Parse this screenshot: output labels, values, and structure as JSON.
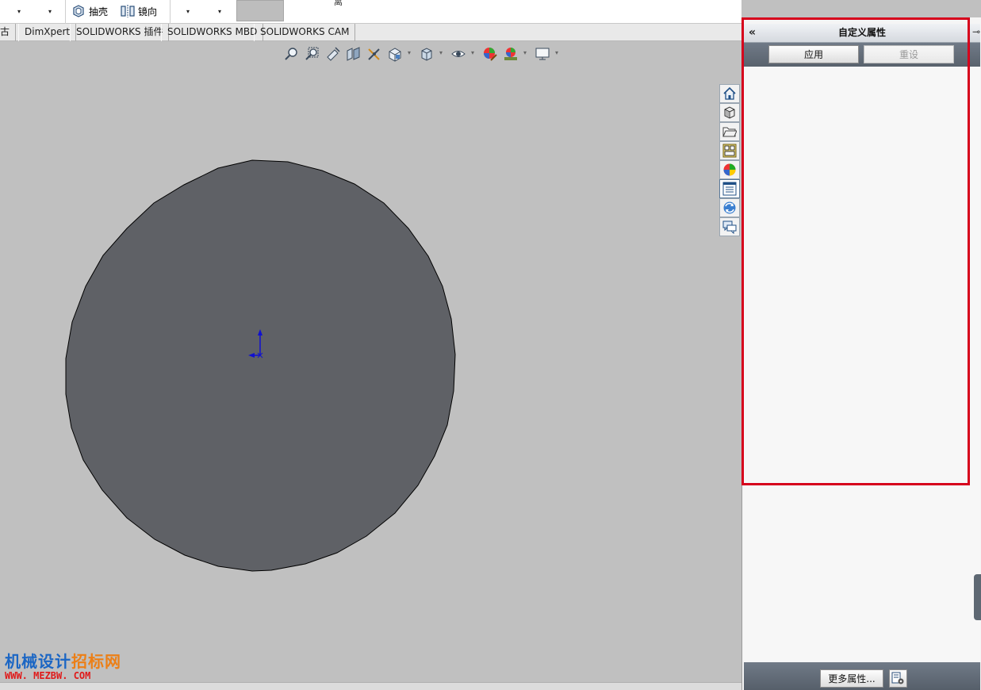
{
  "toolbar": {
    "shell_label": "抽壳",
    "mirror_label": "镜向",
    "top_char": "离"
  },
  "tabs": [
    {
      "label": "古"
    },
    {
      "label": "DimXpert"
    },
    {
      "label": "SOLIDWORKS 插件"
    },
    {
      "label": "SOLIDWORKS MBD"
    },
    {
      "label": "SOLIDWORKS CAM"
    }
  ],
  "heads_up_icons": [
    "zoom-to-fit-icon",
    "zoom-to-area-icon",
    "previous-view-icon",
    "section-view-icon",
    "dynamic-annotation-icon",
    "view-orientation-icon",
    "display-style-icon",
    "hide-show-items-icon",
    "edit-appearance-icon",
    "apply-scene-icon",
    "view-settings-icon"
  ],
  "task_pane_icons": [
    "home-icon",
    "design-library-icon",
    "file-explorer-icon",
    "view-palette-icon",
    "appearances-icon",
    "custom-properties-icon",
    "solidworks-resources-icon",
    "forum-icon"
  ],
  "panel": {
    "title": "自定义属性",
    "apply_label": "应用",
    "reset_label": "重设",
    "more_label": "更多属性...",
    "accent_color": "#d6001c"
  },
  "watermark": {
    "name_part1": "机械设计",
    "name_part2": "招标网",
    "url": "WWW. MEZBW. COM"
  },
  "colors": {
    "model_fill": "#5f6166",
    "viewport_bg": "#c0c0c0",
    "axis": "#1010d0"
  }
}
